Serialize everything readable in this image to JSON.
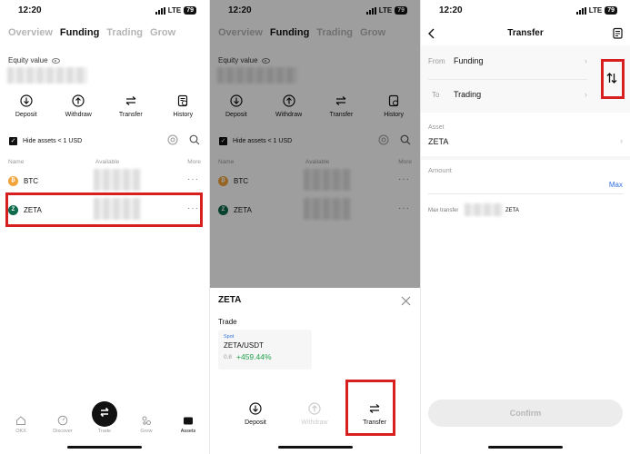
{
  "status": {
    "time": "12:20",
    "network": "LTE",
    "battery": "79"
  },
  "assets_screen": {
    "tabs": [
      "Overview",
      "Funding",
      "Trading",
      "Grow"
    ],
    "active_tab": "Funding",
    "equity_label": "Equity value",
    "actions": [
      {
        "label": "Deposit",
        "icon": "deposit-icon"
      },
      {
        "label": "Withdraw",
        "icon": "withdraw-icon"
      },
      {
        "label": "Transfer",
        "icon": "transfer-icon"
      },
      {
        "label": "History",
        "icon": "history-icon"
      }
    ],
    "hide_small_label": "Hide assets < 1 USD",
    "columns": [
      "Name",
      "Available",
      "More"
    ],
    "rows": [
      {
        "symbol": "BTC",
        "more": "···"
      },
      {
        "symbol": "ZETA",
        "more": "···"
      }
    ],
    "bottom_nav": [
      "OKX",
      "Discover",
      "Trade",
      "Grow",
      "Assets"
    ],
    "active_nav": "Assets"
  },
  "zeta_sheet": {
    "title": "ZETA",
    "section": "Trade",
    "pair_type": "Spot",
    "pair": "ZETA/USDT",
    "price": "0.8",
    "change": "+459.44%",
    "actions": [
      "Deposit",
      "Withdraw",
      "Transfer"
    ]
  },
  "transfer_screen": {
    "title": "Transfer",
    "from_label": "From",
    "from_value": "Funding",
    "to_label": "To",
    "to_value": "Trading",
    "asset_label": "Asset",
    "asset_value": "ZETA",
    "amount_label": "Amount",
    "max_label": "Max",
    "max_transfer_label": "Max transfer",
    "max_transfer_unit": "ZETA",
    "confirm_label": "Confirm"
  },
  "colors": {
    "highlight": "#d71f1f",
    "positive": "#1fa34a",
    "zeta_brand": "#0e6b4d",
    "btc_brand": "#f2a33a",
    "max_link": "#2f6fe0"
  }
}
